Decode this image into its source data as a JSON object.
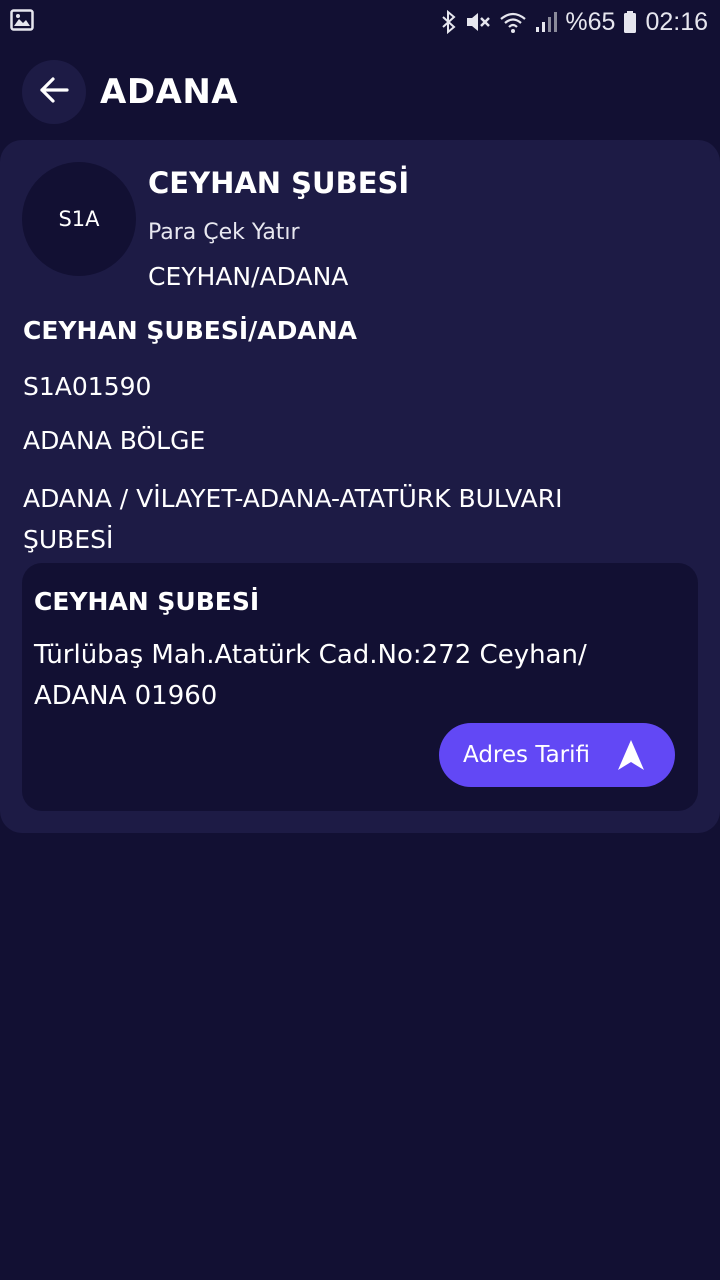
{
  "status_bar": {
    "battery_text": "%65",
    "time": "02:16",
    "icons": [
      "gallery-icon",
      "bluetooth-icon",
      "mute-icon",
      "wifi-icon",
      "signal-icon",
      "battery-icon"
    ]
  },
  "header": {
    "title": "ADANA",
    "back_icon": "arrow-left-icon"
  },
  "branch": {
    "avatar_text": "S1A",
    "name": "CEYHAN ŞUBESİ",
    "type": "Para Çek Yatır",
    "city": "CEYHAN/ADANA",
    "full_name": "CEYHAN ŞUBESİ/ADANA",
    "code": "S1A01590",
    "region": "ADANA BÖLGE",
    "parent_branch": "ADANA / VİLAYET-ADANA-ATATÜRK BULVARI ŞUBESİ"
  },
  "address": {
    "title": "CEYHAN ŞUBESİ",
    "text": "Türlübaş Mah.Atatürk Cad.No:272 Ceyhan/ ADANA 01960",
    "button_label": "Adres Tarifi",
    "button_icon": "navigation-arrow-icon"
  },
  "colors": {
    "background": "#121033",
    "card": "#1d1b45",
    "accent": "#6248f5",
    "text": "#ffffff"
  }
}
